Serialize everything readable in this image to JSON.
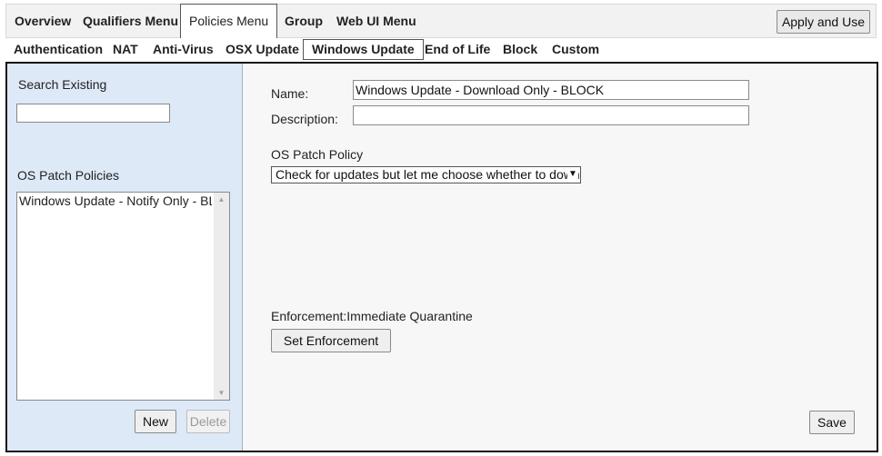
{
  "top_menu": {
    "items": [
      "Overview",
      "Qualifiers Menu",
      "Policies Menu",
      "Group",
      "Web UI Menu"
    ],
    "active": "Policies Menu",
    "apply_button": "Apply and Use"
  },
  "sub_menu": {
    "items": [
      "Authentication",
      "NAT",
      "Anti-Virus",
      "OSX Update",
      "Windows Update",
      "End of Life",
      "Block",
      "Custom"
    ],
    "active": "Windows Update"
  },
  "sidebar": {
    "search_label": "Search Existing",
    "search_value": "",
    "policies_label": "OS Patch Policies",
    "policies": [
      "Windows Update - Notify Only - BLOCK"
    ],
    "new_button": "New",
    "delete_button": "Delete"
  },
  "form": {
    "name_label": "Name:",
    "name_value": "Windows Update - Download Only - BLOCK",
    "description_label": "Description:",
    "description_value": "",
    "os_patch_label": "OS Patch Policy",
    "os_patch_value": "Check for updates but let me choose whether to download",
    "enforcement_label": "Enforcement:",
    "enforcement_value": "Immediate Quarantine",
    "set_enforcement_button": "Set Enforcement",
    "save_button": "Save"
  }
}
